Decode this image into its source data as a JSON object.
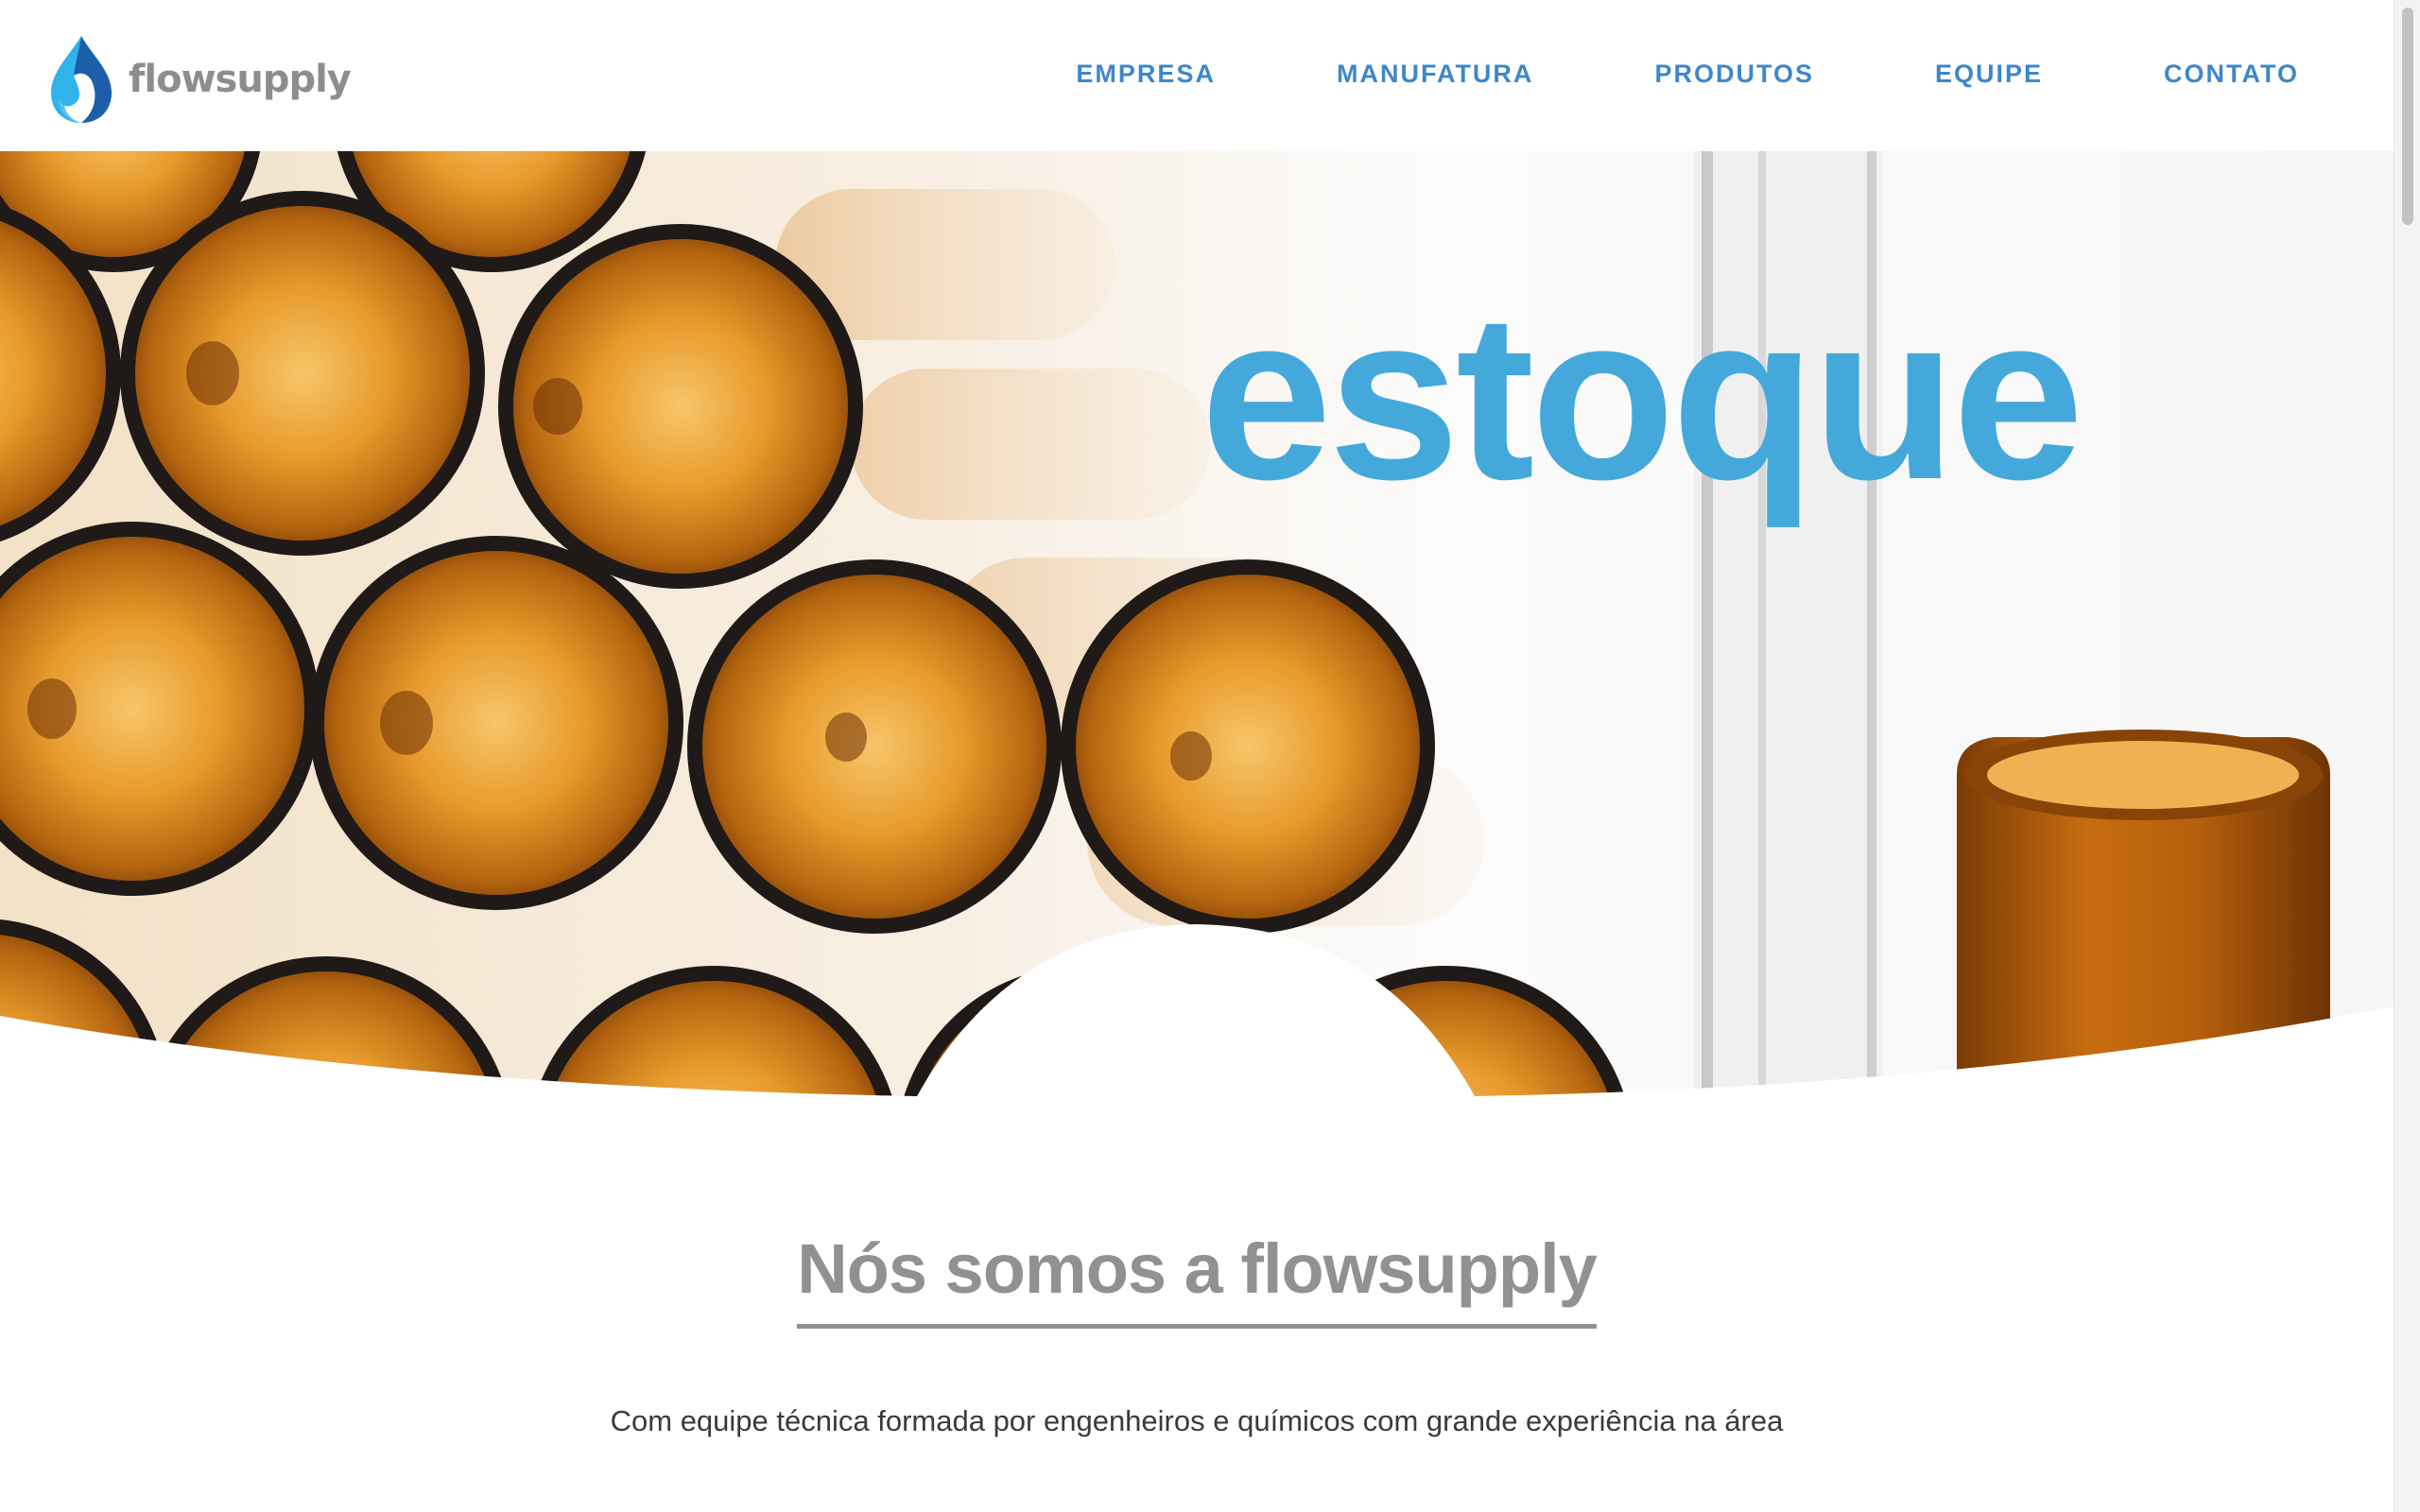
{
  "brand": {
    "name": "flowsupply",
    "colors": {
      "primary": "#44a9da",
      "nav": "#3d87c9",
      "dark_blue": "#1c5fa8",
      "gray": "#8c8d91"
    }
  },
  "nav": {
    "items": [
      {
        "label": "EMPRESA"
      },
      {
        "label": "MANUFATURA"
      },
      {
        "label": "PRODUTOS"
      },
      {
        "label": "EQUIPE"
      },
      {
        "label": "CONTATO"
      }
    ]
  },
  "hero": {
    "headline": "estoque",
    "slide_count": 4,
    "active_slide": 2
  },
  "about": {
    "title": "Nós somos a flowsupply",
    "text": "Com equipe técnica formada por engenheiros e químicos com grande experiência na área"
  }
}
